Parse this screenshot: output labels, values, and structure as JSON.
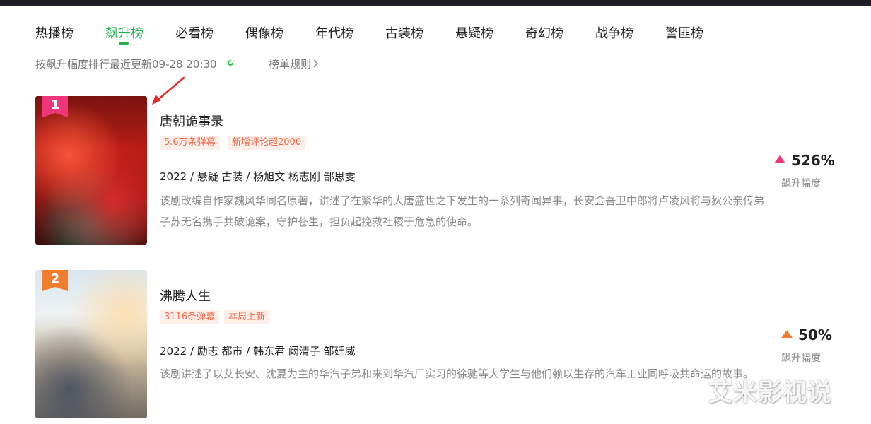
{
  "tabs": [
    {
      "label": "热播榜"
    },
    {
      "label": "飙升榜",
      "active": true
    },
    {
      "label": "必看榜"
    },
    {
      "label": "偶像榜"
    },
    {
      "label": "年代榜"
    },
    {
      "label": "古装榜"
    },
    {
      "label": "悬疑榜"
    },
    {
      "label": "奇幻榜"
    },
    {
      "label": "战争榜"
    },
    {
      "label": "警匪榜"
    }
  ],
  "subline": {
    "sort_text": "按飙升幅度排行最近更新09-28 20:30",
    "rules_link": "榜单规则"
  },
  "items": [
    {
      "rank": "1",
      "title": "唐朝诡事录",
      "tags": [
        "5.6万条弹幕",
        "新增评论超2000"
      ],
      "meta": "2022 / 悬疑 古装 / 杨旭文 杨志刚 郜思雯",
      "desc": "该剧改编自作家魏风华同名原著，讲述了在繁华的大唐盛世之下发生的一系列奇闻异事，长安金吾卫中郎将卢凌风将与狄公亲传弟子苏无名携手共破诡案，守护苍生，担负起挽救社稷于危急的使命。",
      "rise_value": "526%",
      "rise_label": "飙升幅度"
    },
    {
      "rank": "2",
      "title": "沸腾人生",
      "tags": [
        "3116条弹幕",
        "本周上新"
      ],
      "meta": "2022 / 励志 都市 / 韩东君 阚清子 邹廷威",
      "desc": "该剧讲述了以艾长安、沈夏为主的华汽子弟和来到华汽厂实习的徐驰等大学生与他们赖以生存的汽车工业同呼吸共命运的故事。",
      "rise_value": "50%",
      "rise_label": "飙升幅度"
    }
  ],
  "watermark": "艾米影视说",
  "colors": {
    "accent_green": "#1fb34a",
    "rank1_pink": "#f0357a",
    "rank2_orange": "#f27d2e",
    "tag_text": "#f06a4a",
    "tag_bg": "#fdeeea",
    "arrow_red": "#e8262b"
  }
}
